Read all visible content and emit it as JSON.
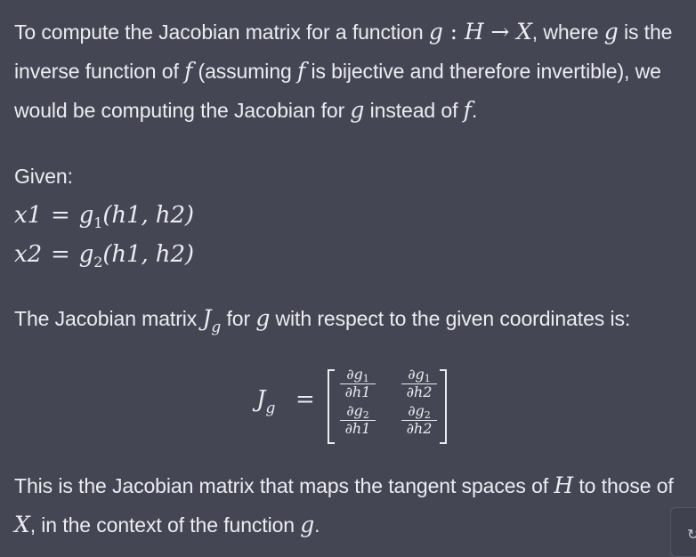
{
  "message": {
    "p1": {
      "t1": "To compute the Jacobian matrix for a function ",
      "m1": "g",
      "m2": " : ",
      "m3": "H",
      "m4": " → ",
      "m5": "X",
      "t2": ", where ",
      "m6": "g",
      "t3": " is the inverse function of ",
      "m7": "f",
      "t4": " (assuming ",
      "m8": "f",
      "t5": " is bijective and therefore invertible), we would be computing the Jacobian for ",
      "m9": "g",
      "t6": " instead of ",
      "m10": "f",
      "t7": "."
    },
    "given_label": "Given:",
    "eq1": {
      "lhs": "x1",
      "op": "=",
      "fn": "g",
      "sub": "1",
      "args": "(h1, h2)"
    },
    "eq2": {
      "lhs": "x2",
      "op": "=",
      "fn": "g",
      "sub": "2",
      "args": "(h1, h2)"
    },
    "p2": {
      "t1": "The Jacobian matrix ",
      "j": "J",
      "jsub": "g",
      "t2": " for ",
      "g": "g",
      "t3": " with respect to the given coordinates is:"
    },
    "matrix": {
      "label": "J",
      "label_sub": "g",
      "eq": "=",
      "cells": [
        {
          "num": "∂g",
          "num_sub": "1",
          "den": "∂h1"
        },
        {
          "num": "∂g",
          "num_sub": "1",
          "den": "∂h2"
        },
        {
          "num": "∂g",
          "num_sub": "2",
          "den": "∂h1"
        },
        {
          "num": "∂g",
          "num_sub": "2",
          "den": "∂h2"
        }
      ]
    },
    "p3": {
      "t1": "This is the Jacobian matrix that maps the tangent spaces of ",
      "m1": "H",
      "t2": " to those of ",
      "m2": "X",
      "t3": ", in the context of the function ",
      "m3": "g",
      "t4": "."
    }
  },
  "regenerate": {
    "icon": "↻"
  }
}
